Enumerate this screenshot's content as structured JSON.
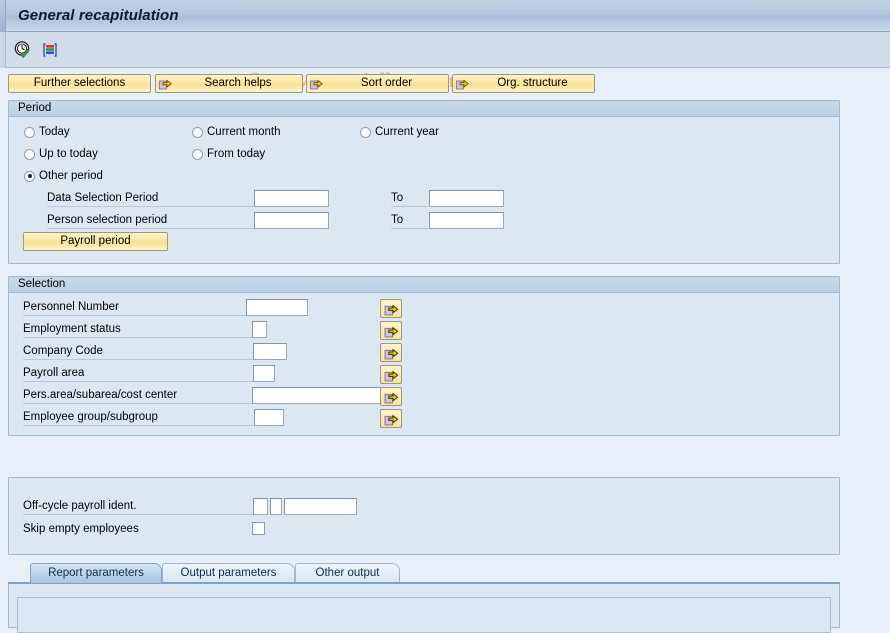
{
  "window": {
    "title": "General recapitulation"
  },
  "toolbar": {
    "icons": [
      {
        "name": "execute-clock-icon",
        "title": "Execute"
      },
      {
        "name": "layout-list-icon",
        "title": "Layout"
      }
    ],
    "watermark": "© www.tutorialkart.com"
  },
  "buttonbar": {
    "buttons": [
      {
        "label": "Further selections",
        "icon": false
      },
      {
        "label": "Search helps",
        "icon": true
      },
      {
        "label": "Sort order",
        "icon": true
      },
      {
        "label": "Org. structure",
        "icon": true
      }
    ]
  },
  "period": {
    "header": "Period",
    "radios": [
      {
        "label": "Today",
        "checked": false
      },
      {
        "label": "Current month",
        "checked": false
      },
      {
        "label": "Current year",
        "checked": false
      },
      {
        "label": "Up to today",
        "checked": false
      },
      {
        "label": "From today",
        "checked": false
      },
      {
        "label": "Other period",
        "checked": true
      }
    ],
    "fields": [
      {
        "label": "Data Selection Period",
        "value": "",
        "to_label": "To",
        "to_value": ""
      },
      {
        "label": "Person selection period",
        "value": "",
        "to_label": "To",
        "to_value": ""
      }
    ],
    "payroll_period_button": "Payroll period"
  },
  "selection": {
    "header": "Selection",
    "rows": [
      {
        "label": "Personnel Number",
        "value": ""
      },
      {
        "label": "Employment status",
        "value": ""
      },
      {
        "label": "Company Code",
        "value": ""
      },
      {
        "label": "Payroll area",
        "value": ""
      },
      {
        "label": "Pers.area/subarea/cost center",
        "value": ""
      },
      {
        "label": "Employee group/subgroup",
        "value": ""
      }
    ]
  },
  "options": {
    "offcycle_label": "Off-cycle payroll ident.",
    "offcycle_value_1": "",
    "offcycle_value_2": "",
    "offcycle_value_3": "",
    "skip_empty_label": "Skip empty employees",
    "skip_empty_checked": false
  },
  "tabs": [
    {
      "label": "Report parameters",
      "active": true
    },
    {
      "label": "Output parameters",
      "active": false
    },
    {
      "label": "Other output",
      "active": false
    }
  ],
  "colors": {
    "button_yellow": "#fae79e",
    "panel_bg": "#dde7f2",
    "page_bg": "#e8eff8",
    "titlebar": "#b2c6dd",
    "watermark": "#eaab80"
  }
}
